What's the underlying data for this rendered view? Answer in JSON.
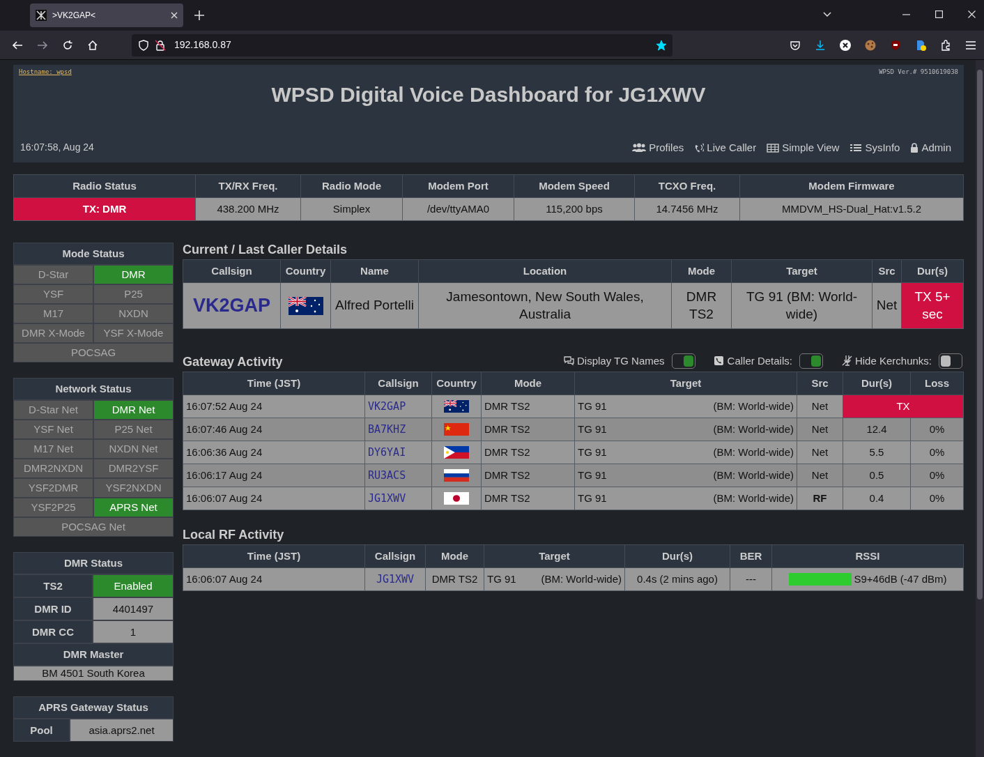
{
  "browser": {
    "tab_title": ">VK2GAP<",
    "url": "192.168.0.87",
    "bookmarked": true
  },
  "header": {
    "hostname": "Hostname: wpsd",
    "version": "WPSD Ver.# 9510619038",
    "title": "WPSD Digital Voice Dashboard for JG1XWV",
    "datetime": "16:07:58, Aug 24",
    "nav": [
      {
        "label": "Profiles"
      },
      {
        "label": "Live Caller"
      },
      {
        "label": "Simple View"
      },
      {
        "label": "SysInfo"
      },
      {
        "label": "Admin"
      }
    ]
  },
  "radio_info": {
    "columns": [
      "Radio Status",
      "TX/RX Freq.",
      "Radio Mode",
      "Modem Port",
      "Modem Speed",
      "TCXO Freq.",
      "Modem Firmware"
    ],
    "values": [
      {
        "text": "TX: DMR",
        "kind": "tx"
      },
      {
        "text": "438.200 MHz",
        "kind": "plain"
      },
      {
        "text": "Simplex",
        "kind": "plain"
      },
      {
        "text": "/dev/ttyAMA0",
        "kind": "plain"
      },
      {
        "text": "115,200 bps",
        "kind": "plain"
      },
      {
        "text": "14.7456 MHz",
        "kind": "plain"
      },
      {
        "text": "MMDVM_HS-Dual_Hat:v1.5.2",
        "kind": "plain"
      }
    ]
  },
  "mode_status": {
    "title": "Mode Status",
    "items": [
      {
        "label": "D-Star",
        "active": false
      },
      {
        "label": "DMR",
        "active": true
      },
      {
        "label": "YSF",
        "active": false
      },
      {
        "label": "P25",
        "active": false
      },
      {
        "label": "M17",
        "active": false
      },
      {
        "label": "NXDN",
        "active": false
      },
      {
        "label": "DMR X-Mode",
        "active": false
      },
      {
        "label": "YSF X-Mode",
        "active": false
      },
      {
        "label": "POCSAG",
        "active": false
      }
    ]
  },
  "network_status": {
    "title": "Network Status",
    "items": [
      {
        "label": "D-Star Net",
        "active": false
      },
      {
        "label": "DMR Net",
        "active": true
      },
      {
        "label": "YSF Net",
        "active": false
      },
      {
        "label": "P25 Net",
        "active": false
      },
      {
        "label": "M17 Net",
        "active": false
      },
      {
        "label": "NXDN Net",
        "active": false
      },
      {
        "label": "DMR2NXDN",
        "active": false
      },
      {
        "label": "DMR2YSF",
        "active": false
      },
      {
        "label": "YSF2DMR",
        "active": false
      },
      {
        "label": "YSF2NXDN",
        "active": false
      },
      {
        "label": "YSF2P25",
        "active": false
      },
      {
        "label": "APRS Net",
        "active": true
      },
      {
        "label": "POCSAG Net",
        "active": false
      }
    ]
  },
  "dmr_status": {
    "title": "DMR Status",
    "rows": [
      {
        "label": "TS2",
        "value": "Enabled",
        "active": true
      },
      {
        "label": "DMR ID",
        "value": "4401497",
        "active": false
      },
      {
        "label": "DMR CC",
        "value": "1",
        "active": false
      }
    ],
    "master_title": "DMR Master",
    "master": "BM 4501 South Korea"
  },
  "aprs_status": {
    "title": "APRS Gateway Status",
    "rows": [
      {
        "label": "Pool",
        "value": "asia.aprs2.net"
      }
    ]
  },
  "caller": {
    "title": "Current / Last Caller Details",
    "columns": [
      "Callsign",
      "Country",
      "Name",
      "Location",
      "Mode",
      "Target",
      "Src",
      "Dur(s)"
    ],
    "row": {
      "callsign": "VK2GAP",
      "country_flag": {
        "kind": "au"
      },
      "name": "Alfred Portelli",
      "location": "Jamesontown, New South Wales, Australia",
      "mode": "DMR TS2",
      "target": "TG 91 (BM: World-wide)",
      "src": "Net",
      "duration": "TX 5+ sec",
      "tx": true
    }
  },
  "gateway": {
    "title": "Gateway Activity",
    "toggles": [
      {
        "label": "Display TG Names",
        "on": true
      },
      {
        "label": "Caller Details:",
        "on": true
      },
      {
        "label": "Hide Kerchunks:",
        "on": false
      }
    ],
    "columns": [
      "Time (JST)",
      "Callsign",
      "Country",
      "Mode",
      "Target",
      "Src",
      "Dur(s)",
      "Loss"
    ],
    "rows": [
      {
        "time": "16:07:52 Aug 24",
        "callsign": "VK2GAP",
        "country_flag": {
          "kind": "au"
        },
        "mode": "DMR TS2",
        "tg": "TG 91",
        "tg_name": "(BM: World-wide)",
        "src": "Net",
        "src_highlight": false,
        "tx": true,
        "duration": "TX"
      },
      {
        "time": "16:07:46 Aug 24",
        "callsign": "BA7KHZ",
        "country_flag": {
          "kind": "cn"
        },
        "mode": "DMR TS2",
        "tg": "TG 91",
        "tg_name": "(BM: World-wide)",
        "src": "Net",
        "src_highlight": false,
        "tx": false,
        "duration": "12.4",
        "loss": "0%"
      },
      {
        "time": "16:06:36 Aug 24",
        "callsign": "DY6YAI",
        "country_flag": {
          "kind": "ph"
        },
        "mode": "DMR TS2",
        "tg": "TG 91",
        "tg_name": "(BM: World-wide)",
        "src": "Net",
        "src_highlight": false,
        "tx": false,
        "duration": "5.5",
        "loss": "0%"
      },
      {
        "time": "16:06:17 Aug 24",
        "callsign": "RU3ACS",
        "country_flag": {
          "kind": "ru"
        },
        "mode": "DMR TS2",
        "tg": "TG 91",
        "tg_name": "(BM: World-wide)",
        "src": "Net",
        "src_highlight": false,
        "tx": false,
        "duration": "0.5",
        "loss": "0%"
      },
      {
        "time": "16:06:07 Aug 24",
        "callsign": "JG1XWV",
        "country_flag": {
          "kind": "jp"
        },
        "mode": "DMR TS2",
        "tg": "TG 91",
        "tg_name": "(BM: World-wide)",
        "src": "RF",
        "src_highlight": true,
        "tx": false,
        "duration": "0.4",
        "loss": "0%"
      }
    ]
  },
  "local_rf": {
    "title": "Local RF Activity",
    "columns": [
      "Time (JST)",
      "Callsign",
      "Mode",
      "Target",
      "Dur(s)",
      "BER",
      "RSSI"
    ],
    "rows": [
      {
        "time": "16:06:07 Aug 24",
        "callsign": "JG1XWV",
        "mode": "DMR TS2",
        "tg": "TG 91",
        "tg_name": "(BM: World-wide)",
        "duration": "0.4s (2 mins ago)",
        "ber": "---",
        "rssi": "S9+46dB (-47 dBm)"
      }
    ]
  }
}
